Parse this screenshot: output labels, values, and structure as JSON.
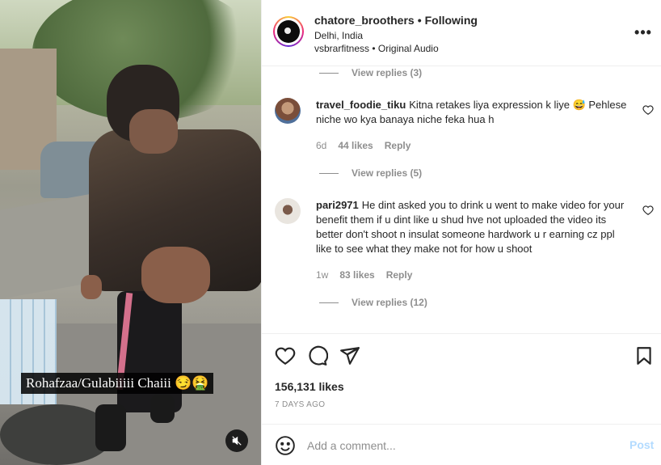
{
  "media": {
    "caption": "Rohafzaa/Gulabiiiii Chaiii 😏🤮",
    "mute_icon": "speaker-muted-icon"
  },
  "header": {
    "username": "chatore_broothers",
    "separator": "•",
    "follow_status": "Following",
    "location": "Delhi, India",
    "audio_user": "vsbrarfitness",
    "audio_separator": "•",
    "audio_label": "Original Audio",
    "more_icon": "•••"
  },
  "comments": {
    "top_replies": "View replies (3)",
    "items": [
      {
        "username": "travel_foodie_tiku",
        "text": "Kitna retakes liya expression k liye 😅 Pehlese niche wo kya banaya niche feka hua h",
        "age": "6d",
        "likes": "44 likes",
        "reply": "Reply",
        "replies": "View replies (5)",
        "avatar_color": "#b0836a"
      },
      {
        "username": "pari2971",
        "text": "He dint asked you to drink u went to make video for your benefit them if u dint like u shud hve not uploaded the video its better don't shoot n insulat someone hardwork u r earning cz ppl like to see what they make not for how u shoot",
        "age": "1w",
        "likes": "83 likes",
        "reply": "Reply",
        "replies": "View replies (12)",
        "avatar_color": "#d9d4cc"
      }
    ]
  },
  "actions": {
    "likes": "156,131 likes",
    "date": "7 DAYS AGO"
  },
  "add_comment": {
    "placeholder": "Add a comment...",
    "post_label": "Post"
  },
  "colors": {
    "text": "#262626",
    "muted": "#8e8e8e",
    "border": "#efefef",
    "post_disabled": "#b3dbff"
  }
}
